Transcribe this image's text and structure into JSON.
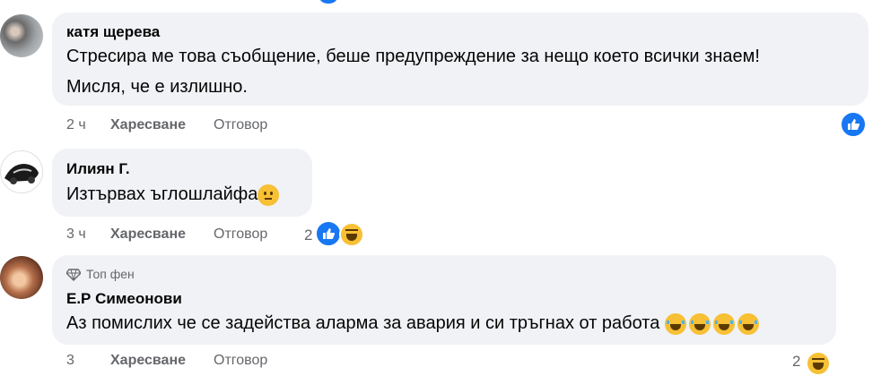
{
  "comments": [
    {
      "author": "катя щерева",
      "lines": [
        "Стресира ме това съобщение, беше предупреждение за нещо което всички знаем!",
        "Мисля, че е излишно."
      ],
      "time": "2 ч",
      "like_label": "Харесване",
      "reply_label": "Отговор",
      "reaction_icon": "like-icon"
    },
    {
      "author": "Илиян Г.",
      "text": "Изтървах ъглошлайфа",
      "emoji": "neutral-face-emoji",
      "time": "3 ч",
      "like_label": "Харесване",
      "reply_label": "Отговор",
      "reaction_count": "2",
      "reaction_icons": [
        "like-icon",
        "haha-icon"
      ]
    },
    {
      "badge": "Топ фен",
      "author": "Е.Р Симеонови",
      "text": "Аз помислих че се задейства аларма за авария и си тръгнах от работа",
      "emojis": [
        "laughing-emoji",
        "laughing-emoji",
        "laughing-emoji",
        "laughing-emoji"
      ],
      "time": "3",
      "like_label": "Харесване",
      "reply_label": "Отговор",
      "reaction_count": "2"
    }
  ],
  "colors": {
    "bubble": "#f0f2f5",
    "meta": "#65676b",
    "accent": "#1877f2"
  }
}
